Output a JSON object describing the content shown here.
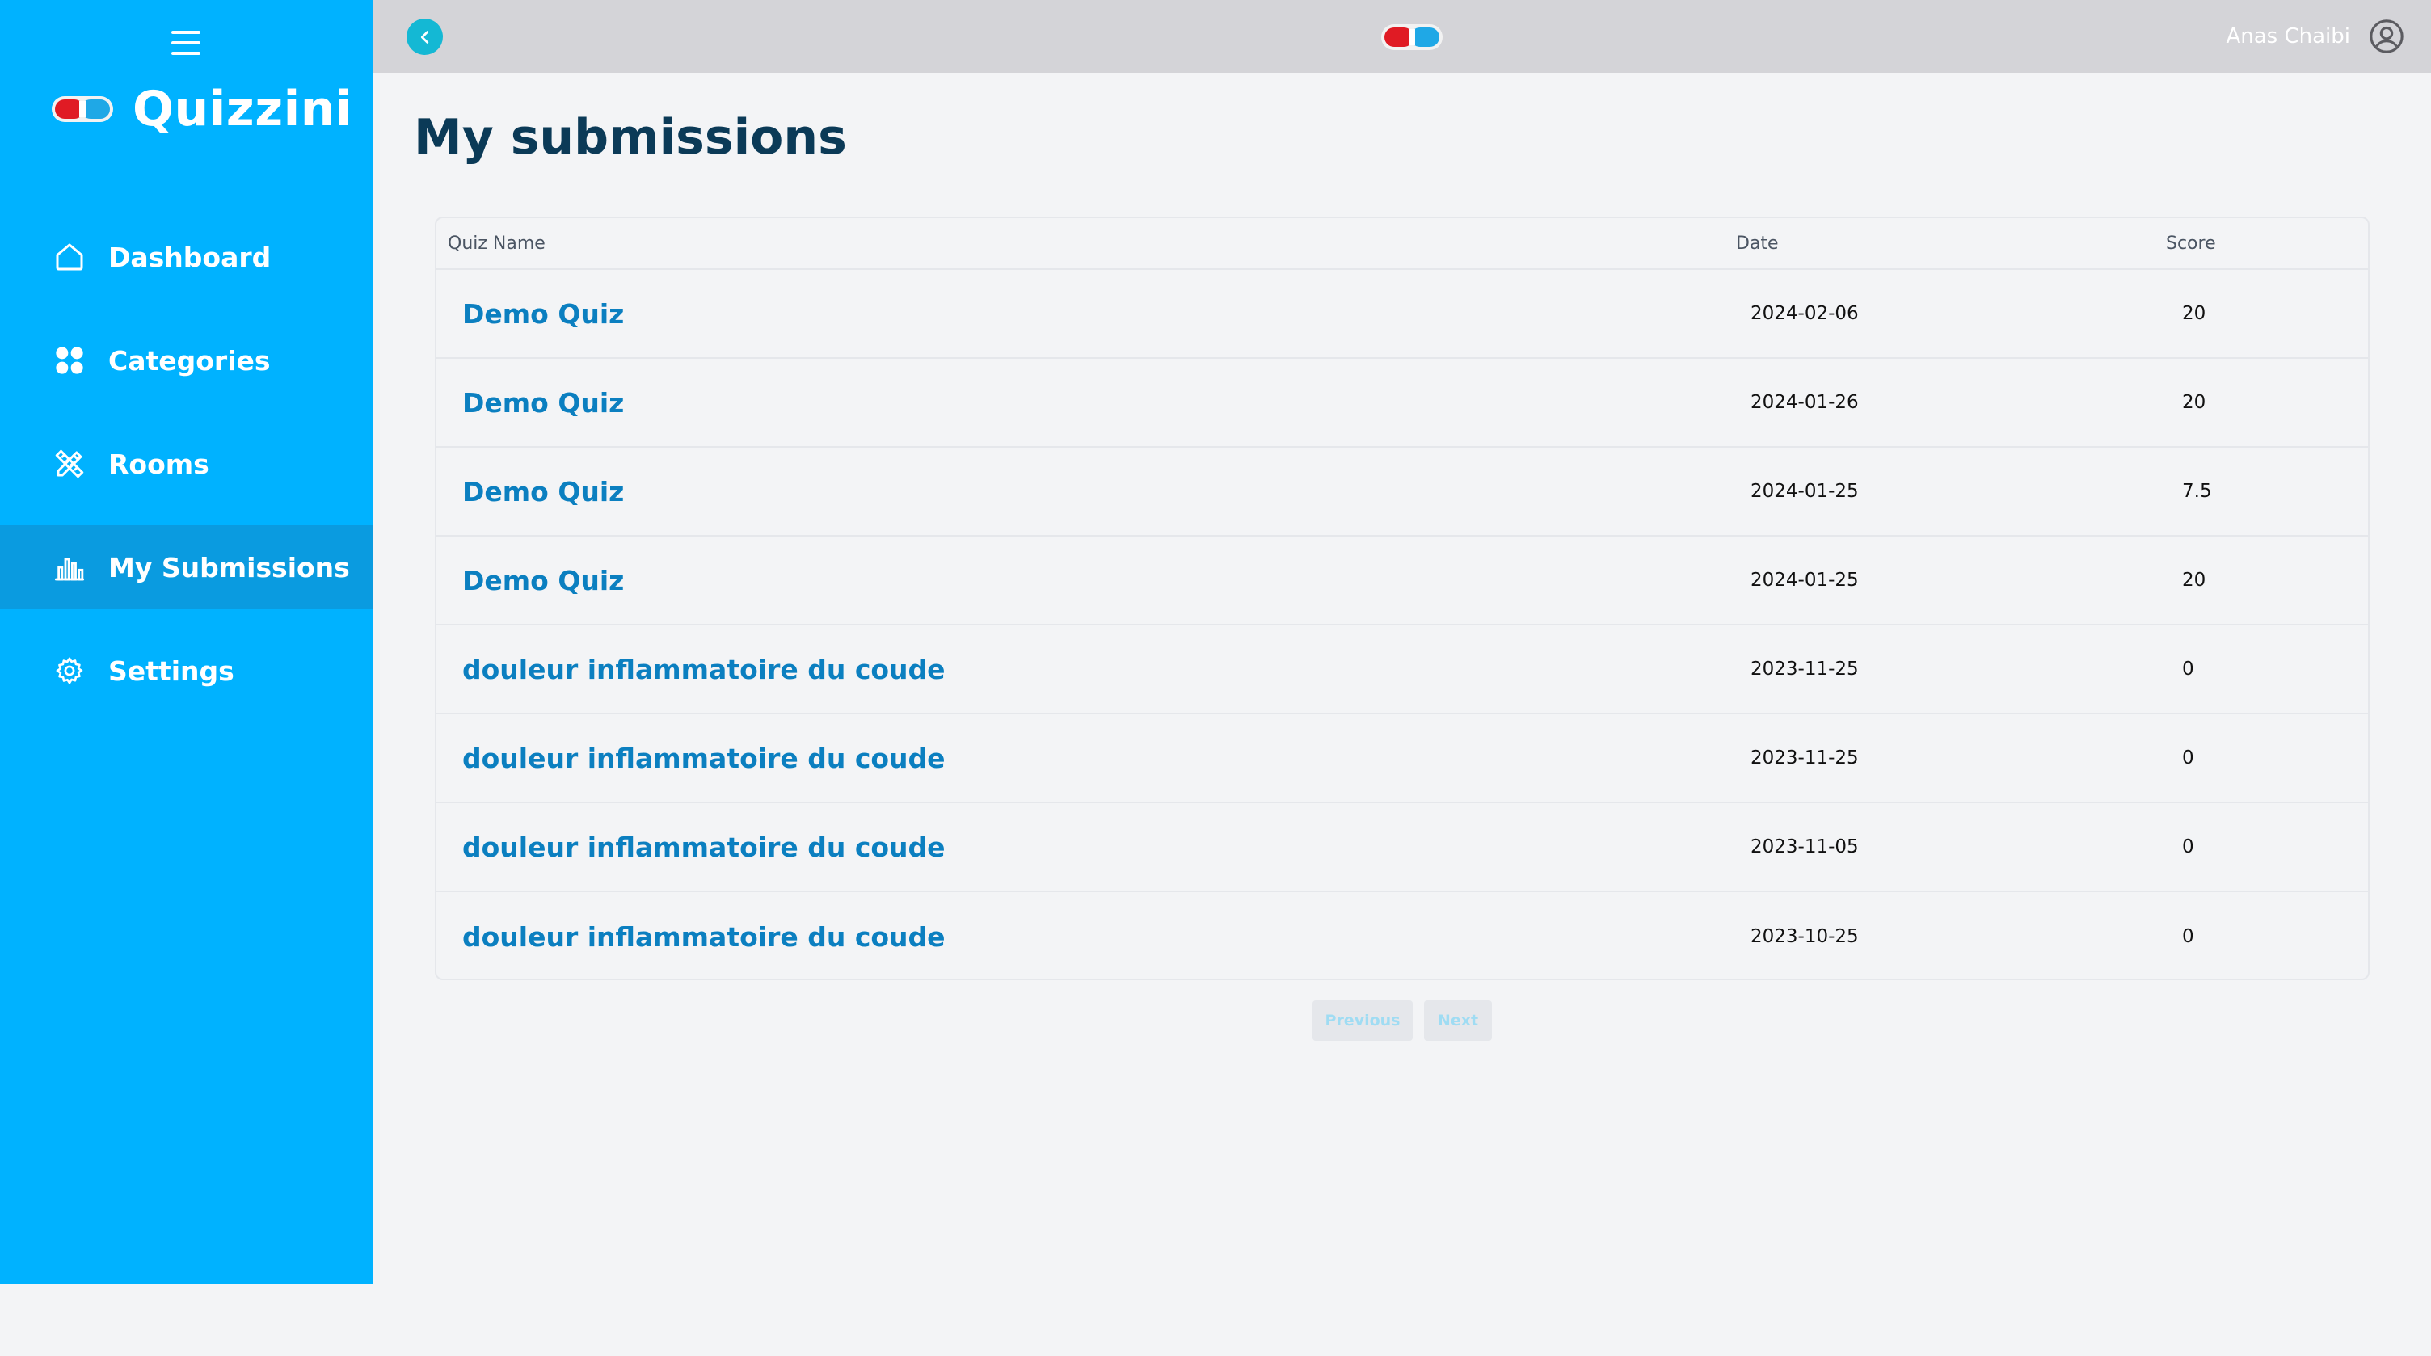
{
  "brand": {
    "name": "Quizzini"
  },
  "sidebar": {
    "items": [
      {
        "label": "Dashboard",
        "icon": "home-icon"
      },
      {
        "label": "Categories",
        "icon": "grid-icon"
      },
      {
        "label": "Rooms",
        "icon": "ruler-pencil-icon"
      },
      {
        "label": "My Submissions",
        "icon": "bar-chart-icon",
        "active": true
      },
      {
        "label": "Settings",
        "icon": "gear-icon"
      }
    ]
  },
  "header": {
    "user_name": "Anas Chaibi"
  },
  "main": {
    "title": "My submissions",
    "columns": {
      "name": "Quiz Name",
      "date": "Date",
      "score": "Score"
    },
    "rows": [
      {
        "name": "Demo Quiz",
        "date": "2024-02-06",
        "score": "20"
      },
      {
        "name": "Demo Quiz",
        "date": "2024-01-26",
        "score": "20"
      },
      {
        "name": "Demo Quiz",
        "date": "2024-01-25",
        "score": "7.5"
      },
      {
        "name": "Demo Quiz",
        "date": "2024-01-25",
        "score": "20"
      },
      {
        "name": "douleur inflammatoire du coude",
        "date": "2023-11-25",
        "score": "0"
      },
      {
        "name": "douleur inflammatoire du coude",
        "date": "2023-11-25",
        "score": "0"
      },
      {
        "name": "douleur inflammatoire du coude",
        "date": "2023-11-05",
        "score": "0"
      },
      {
        "name": "douleur inflammatoire du coude",
        "date": "2023-10-25",
        "score": "0"
      }
    ],
    "pagination": {
      "previous": "Previous",
      "next": "Next"
    }
  },
  "colors": {
    "sidebar_bg": "#00b2ff",
    "active_item_bg": "#0a9be0",
    "topbar_bg": "#d4d4d8",
    "title": "#0b3a57",
    "link": "#0b7fc0",
    "back_button": "#14b8d4"
  }
}
